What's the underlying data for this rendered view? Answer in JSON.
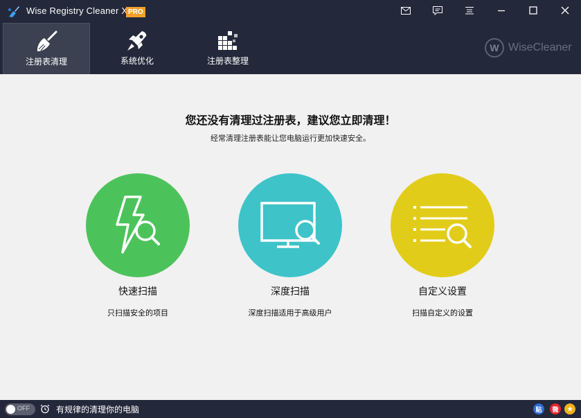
{
  "app": {
    "title": "Wise Registry Cleaner X",
    "badge": "PRO",
    "icon": "broom-app-icon"
  },
  "titlebar_buttons": [
    {
      "name": "mail-icon"
    },
    {
      "name": "feedback-icon"
    },
    {
      "name": "menu-icon"
    },
    {
      "name": "minimize-icon"
    },
    {
      "name": "maximize-icon"
    },
    {
      "name": "close-icon"
    }
  ],
  "nav": {
    "tabs": [
      {
        "label": "注册表清理",
        "icon": "broom-icon",
        "active": true
      },
      {
        "label": "系统优化",
        "icon": "rocket-icon",
        "active": false
      },
      {
        "label": "注册表整理",
        "icon": "blocks-icon",
        "active": false
      }
    ]
  },
  "brand": {
    "logo_letter": "W",
    "name": "WiseCleaner"
  },
  "main": {
    "headline": "您还没有清理过注册表，建议您立即清理！",
    "subline": "经常清理注册表能让您电脑运行更加快速安全。",
    "options": [
      {
        "title": "快速扫描",
        "desc": "只扫描安全的项目",
        "color": "#4cc35a",
        "icon": "lightning-search-icon"
      },
      {
        "title": "深度扫描",
        "desc": "深度扫描适用于高级用户",
        "color": "#3ec3c9",
        "icon": "monitor-search-icon"
      },
      {
        "title": "自定义设置",
        "desc": "扫描自定义的设置",
        "color": "#e2cc1a",
        "icon": "list-search-icon"
      }
    ]
  },
  "status": {
    "toggle_text": "OFF",
    "text": "有规律的清理你的电脑",
    "social": [
      {
        "name": "tieba-icon",
        "glyph": "贴",
        "color": "#2d6cd8"
      },
      {
        "name": "weibo-icon",
        "glyph": "微",
        "color": "#e6262e"
      },
      {
        "name": "star-icon",
        "glyph": "★",
        "color": "#f2b21a"
      }
    ]
  },
  "colors": {
    "dark": "#23283a",
    "active_tab": "#3b4150",
    "background": "#f1f1f1"
  }
}
